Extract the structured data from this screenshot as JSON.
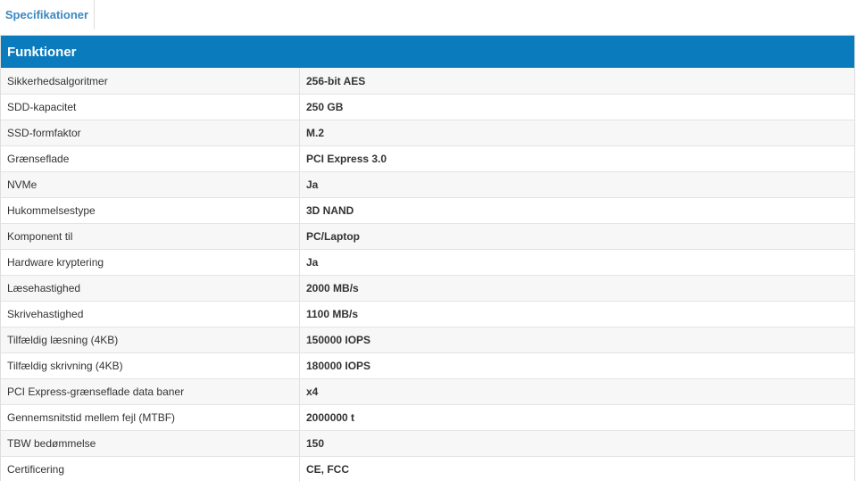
{
  "tabs": [
    {
      "label": "Specifikationer",
      "active": true
    }
  ],
  "section": {
    "title": "Funktioner",
    "header_color": "#0a7bbd"
  },
  "specs": [
    {
      "label": "Sikkerhedsalgoritmer",
      "value": "256-bit AES"
    },
    {
      "label": "SDD-kapacitet",
      "value": "250 GB"
    },
    {
      "label": "SSD-formfaktor",
      "value": "M.2"
    },
    {
      "label": "Grænseflade",
      "value": "PCI Express 3.0"
    },
    {
      "label": "NVMe",
      "value": "Ja"
    },
    {
      "label": "Hukommelsestype",
      "value": "3D NAND"
    },
    {
      "label": "Komponent til",
      "value": "PC/Laptop"
    },
    {
      "label": "Hardware kryptering",
      "value": "Ja"
    },
    {
      "label": "Læsehastighed",
      "value": "2000 MB/s"
    },
    {
      "label": "Skrivehastighed",
      "value": "1100 MB/s"
    },
    {
      "label": "Tilfældig læsning (4KB)",
      "value": "150000 IOPS"
    },
    {
      "label": "Tilfældig skrivning (4KB)",
      "value": "180000 IOPS"
    },
    {
      "label": "PCI Express-grænseflade data baner",
      "value": "x4"
    },
    {
      "label": "Gennemsnitstid mellem fejl (MTBF)",
      "value": "2000000 t"
    },
    {
      "label": "TBW bedømmelse",
      "value": "150"
    },
    {
      "label": "Certificering",
      "value": "CE, FCC"
    }
  ]
}
